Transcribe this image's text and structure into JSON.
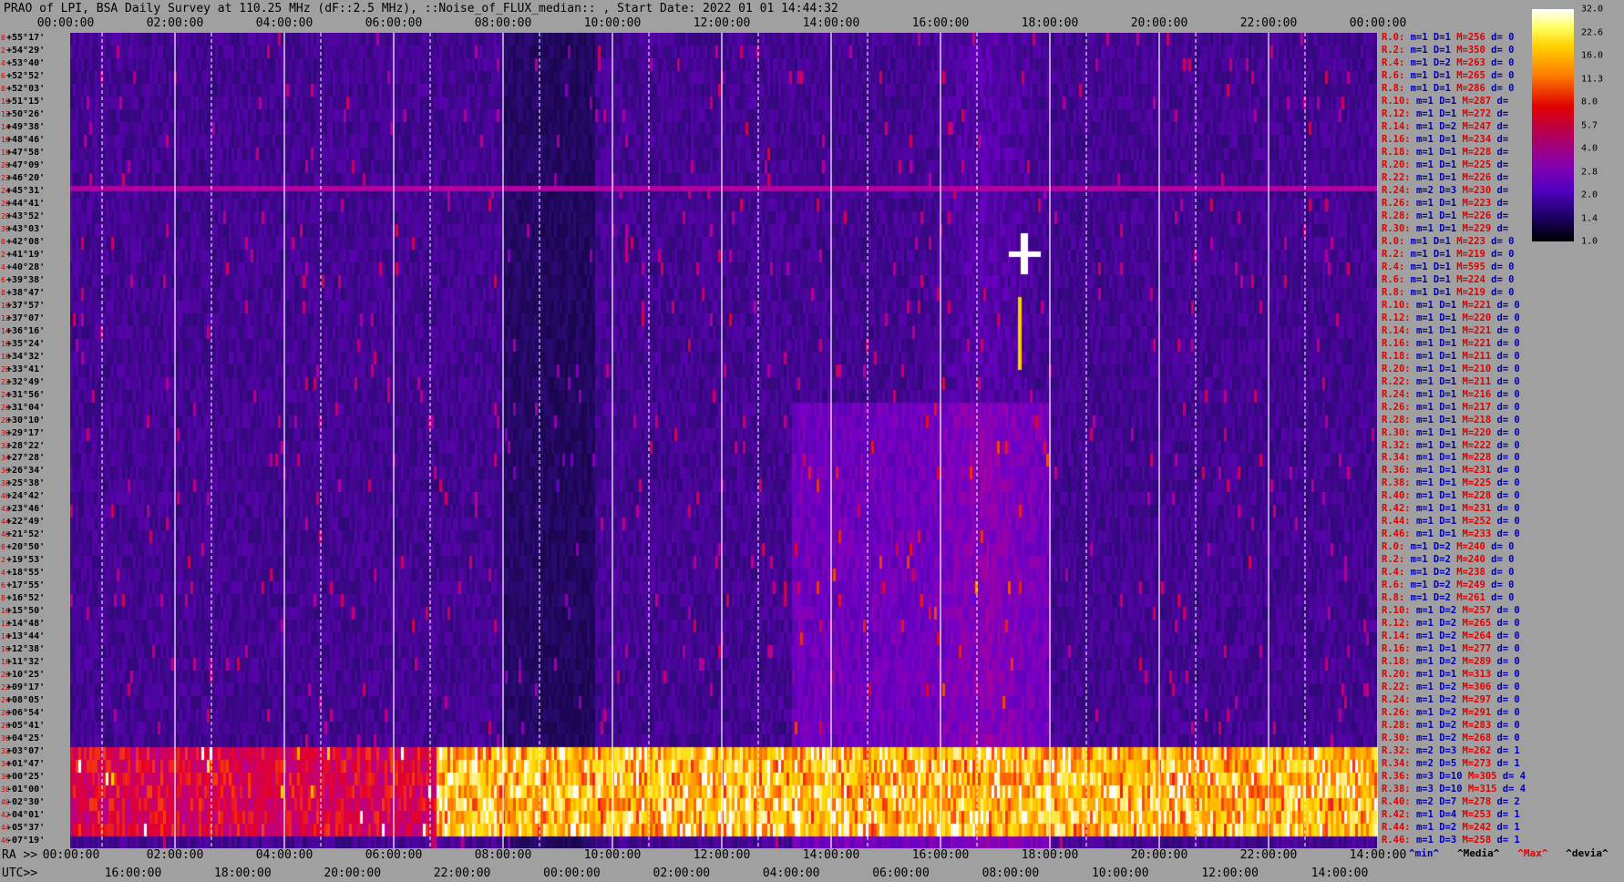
{
  "title": "PRAO of LPI, BSA Daily Survey at 110.25 MHz (dF::2.5 MHz), ::Noise_of_FLUX_median:: , Start Date: 2022 01 01 14:44:32",
  "top_axis": [
    "00:00:00",
    "02:00:00",
    "04:00:00",
    "06:00:00",
    "08:00:00",
    "10:00:00",
    "12:00:00",
    "14:00:00",
    "16:00:00",
    "18:00:00",
    "20:00:00",
    "22:00:00",
    "00:00:00"
  ],
  "ra_axis": [
    "00:00:00",
    "02:00:00",
    "04:00:00",
    "06:00:00",
    "08:00:00",
    "10:00:00",
    "12:00:00",
    "14:00:00",
    "16:00:00",
    "18:00:00",
    "20:00:00",
    "22:00:00",
    "14:00:00"
  ],
  "ra_label": "RA >>",
  "utc_axis": [
    "16:00:00",
    "18:00:00",
    "20:00:00",
    "22:00:00",
    "00:00:00",
    "02:00:00",
    "04:00:00",
    "06:00:00",
    "08:00:00",
    "10:00:00",
    "12:00:00",
    "14:00:00"
  ],
  "utc_label": "UTC>>",
  "declinations": [
    "+55°17'",
    "+54°29'",
    "+53°40'",
    "+52°52'",
    "+52°03'",
    "+51°15'",
    "+50°26'",
    "+49°38'",
    "+48°46'",
    "+47°58'",
    "+47°09'",
    "+46°20'",
    "+45°31'",
    "+44°41'",
    "+43°52'",
    "+43°03'",
    "+42°08'",
    "+41°19'",
    "+40°28'",
    "+39°38'",
    "+38°47'",
    "+37°57'",
    "+37°07'",
    "+36°16'",
    "+35°24'",
    "+34°32'",
    "+33°41'",
    "+32°49'",
    "+31°56'",
    "+31°04'",
    "+30°10'",
    "+29°17'",
    "+28°22'",
    "+27°28'",
    "+26°34'",
    "+25°38'",
    "+24°42'",
    "+23°46'",
    "+22°49'",
    "+21°52'",
    "+20°50'",
    "+19°53'",
    "+18°55'",
    "+17°55'",
    "+16°52'",
    "+15°50'",
    "+14°48'",
    "+13°44'",
    "+12°38'",
    "+11°32'",
    "+10°25'",
    "+09°17'",
    "+08°05'",
    "+06°54'",
    "+05°41'",
    "+04°25'",
    "+03°07'",
    "+01°47'",
    "+00°25'",
    "-01°00'",
    "-02°30'",
    "-04°01'",
    "-05°37'",
    "-07°19'"
  ],
  "row_numbers": [
    "0",
    "2",
    "4",
    "6",
    "8",
    "10",
    "12",
    "14",
    "16",
    "18",
    "20",
    "22",
    "24",
    "26",
    "28",
    "30",
    "0",
    "2",
    "4",
    "6",
    "8",
    "10",
    "12",
    "14",
    "16",
    "18",
    "20",
    "22",
    "24",
    "26",
    "28",
    "30",
    "32",
    "34",
    "36",
    "38",
    "40",
    "42",
    "44",
    "46",
    "0",
    "2",
    "4",
    "6",
    "8",
    "10",
    "12",
    "14",
    "16",
    "18",
    "20",
    "22",
    "24",
    "26",
    "28",
    "30",
    "32",
    "34",
    "36",
    "38",
    "40",
    "42",
    "44",
    "46"
  ],
  "stats": [
    {
      "r": "R.0:",
      "m": "m=1",
      "d": "D=1",
      "M": "M=256",
      "dv": "d= 0"
    },
    {
      "r": "R.2:",
      "m": "m=1",
      "d": "D=1",
      "M": "M=350",
      "dv": "d= 0"
    },
    {
      "r": "R.4:",
      "m": "m=1",
      "d": "D=2",
      "M": "M=263",
      "dv": "d= 0"
    },
    {
      "r": "R.6:",
      "m": "m=1",
      "d": "D=1",
      "M": "M=265",
      "dv": "d= 0"
    },
    {
      "r": "R.8:",
      "m": "m=1",
      "d": "D=1",
      "M": "M=286",
      "dv": "d= 0"
    },
    {
      "r": "R.10:",
      "m": "m=1",
      "d": "D=1",
      "M": "M=287",
      "dv": "d="
    },
    {
      "r": "R.12:",
      "m": "m=1",
      "d": "D=1",
      "M": "M=272",
      "dv": "d="
    },
    {
      "r": "R.14:",
      "m": "m=1",
      "d": "D=2",
      "M": "M=247",
      "dv": "d="
    },
    {
      "r": "R.16:",
      "m": "m=1",
      "d": "D=1",
      "M": "M=234",
      "dv": "d="
    },
    {
      "r": "R.18:",
      "m": "m=1",
      "d": "D=1",
      "M": "M=228",
      "dv": "d="
    },
    {
      "r": "R.20:",
      "m": "m=1",
      "d": "D=1",
      "M": "M=225",
      "dv": "d="
    },
    {
      "r": "R.22:",
      "m": "m=1",
      "d": "D=1",
      "M": "M=226",
      "dv": "d="
    },
    {
      "r": "R.24:",
      "m": "m=2",
      "d": "D=3",
      "M": "M=230",
      "dv": "d="
    },
    {
      "r": "R.26:",
      "m": "m=1",
      "d": "D=1",
      "M": "M=223",
      "dv": "d="
    },
    {
      "r": "R.28:",
      "m": "m=1",
      "d": "D=1",
      "M": "M=226",
      "dv": "d="
    },
    {
      "r": "R.30:",
      "m": "m=1",
      "d": "D=1",
      "M": "M=229",
      "dv": "d="
    },
    {
      "r": "R.0:",
      "m": "m=1",
      "d": "D=1",
      "M": "M=223",
      "dv": "d= 0"
    },
    {
      "r": "R.2:",
      "m": "m=1",
      "d": "D=1",
      "M": "M=219",
      "dv": "d= 0"
    },
    {
      "r": "R.4:",
      "m": "m=1",
      "d": "D=1",
      "M": "M=595",
      "dv": "d= 0"
    },
    {
      "r": "R.6:",
      "m": "m=1",
      "d": "D=1",
      "M": "M=224",
      "dv": "d= 0"
    },
    {
      "r": "R.8:",
      "m": "m=1",
      "d": "D=1",
      "M": "M=219",
      "dv": "d= 0"
    },
    {
      "r": "R.10:",
      "m": "m=1",
      "d": "D=1",
      "M": "M=221",
      "dv": "d= 0"
    },
    {
      "r": "R.12:",
      "m": "m=1",
      "d": "D=1",
      "M": "M=220",
      "dv": "d= 0"
    },
    {
      "r": "R.14:",
      "m": "m=1",
      "d": "D=1",
      "M": "M=221",
      "dv": "d= 0"
    },
    {
      "r": "R.16:",
      "m": "m=1",
      "d": "D=1",
      "M": "M=221",
      "dv": "d= 0"
    },
    {
      "r": "R.18:",
      "m": "m=1",
      "d": "D=1",
      "M": "M=211",
      "dv": "d= 0"
    },
    {
      "r": "R.20:",
      "m": "m=1",
      "d": "D=1",
      "M": "M=210",
      "dv": "d= 0"
    },
    {
      "r": "R.22:",
      "m": "m=1",
      "d": "D=1",
      "M": "M=211",
      "dv": "d= 0"
    },
    {
      "r": "R.24:",
      "m": "m=1",
      "d": "D=1",
      "M": "M=216",
      "dv": "d= 0"
    },
    {
      "r": "R.26:",
      "m": "m=1",
      "d": "D=1",
      "M": "M=217",
      "dv": "d= 0"
    },
    {
      "r": "R.28:",
      "m": "m=1",
      "d": "D=1",
      "M": "M=218",
      "dv": "d= 0"
    },
    {
      "r": "R.30:",
      "m": "m=1",
      "d": "D=1",
      "M": "M=220",
      "dv": "d= 0"
    },
    {
      "r": "R.32:",
      "m": "m=1",
      "d": "D=1",
      "M": "M=222",
      "dv": "d= 0"
    },
    {
      "r": "R.34:",
      "m": "m=1",
      "d": "D=1",
      "M": "M=228",
      "dv": "d= 0"
    },
    {
      "r": "R.36:",
      "m": "m=1",
      "d": "D=1",
      "M": "M=231",
      "dv": "d= 0"
    },
    {
      "r": "R.38:",
      "m": "m=1",
      "d": "D=1",
      "M": "M=225",
      "dv": "d= 0"
    },
    {
      "r": "R.40:",
      "m": "m=1",
      "d": "D=1",
      "M": "M=228",
      "dv": "d= 0"
    },
    {
      "r": "R.42:",
      "m": "m=1",
      "d": "D=1",
      "M": "M=231",
      "dv": "d= 0"
    },
    {
      "r": "R.44:",
      "m": "m=1",
      "d": "D=1",
      "M": "M=252",
      "dv": "d= 0"
    },
    {
      "r": "R.46:",
      "m": "m=1",
      "d": "D=1",
      "M": "M=233",
      "dv": "d= 0"
    },
    {
      "r": "R.0:",
      "m": "m=1",
      "d": "D=2",
      "M": "M=240",
      "dv": "d= 0"
    },
    {
      "r": "R.2:",
      "m": "m=1",
      "d": "D=2",
      "M": "M=240",
      "dv": "d= 0"
    },
    {
      "r": "R.4:",
      "m": "m=1",
      "d": "D=2",
      "M": "M=238",
      "dv": "d= 0"
    },
    {
      "r": "R.6:",
      "m": "m=1",
      "d": "D=2",
      "M": "M=249",
      "dv": "d= 0"
    },
    {
      "r": "R.8:",
      "m": "m=1",
      "d": "D=2",
      "M": "M=261",
      "dv": "d= 0"
    },
    {
      "r": "R.10:",
      "m": "m=1",
      "d": "D=2",
      "M": "M=257",
      "dv": "d= 0"
    },
    {
      "r": "R.12:",
      "m": "m=1",
      "d": "D=2",
      "M": "M=265",
      "dv": "d= 0"
    },
    {
      "r": "R.14:",
      "m": "m=1",
      "d": "D=2",
      "M": "M=264",
      "dv": "d= 0"
    },
    {
      "r": "R.16:",
      "m": "m=1",
      "d": "D=1",
      "M": "M=277",
      "dv": "d= 0"
    },
    {
      "r": "R.18:",
      "m": "m=1",
      "d": "D=2",
      "M": "M=289",
      "dv": "d= 0"
    },
    {
      "r": "R.20:",
      "m": "m=1",
      "d": "D=1",
      "M": "M=313",
      "dv": "d= 0"
    },
    {
      "r": "R.22:",
      "m": "m=1",
      "d": "D=2",
      "M": "M=306",
      "dv": "d= 0"
    },
    {
      "r": "R.24:",
      "m": "m=1",
      "d": "D=2",
      "M": "M=297",
      "dv": "d= 0"
    },
    {
      "r": "R.26:",
      "m": "m=1",
      "d": "D=2",
      "M": "M=291",
      "dv": "d= 0"
    },
    {
      "r": "R.28:",
      "m": "m=1",
      "d": "D=2",
      "M": "M=283",
      "dv": "d= 0"
    },
    {
      "r": "R.30:",
      "m": "m=1",
      "d": "D=2",
      "M": "M=268",
      "dv": "d= 0"
    },
    {
      "r": "R.32:",
      "m": "m=2",
      "d": "D=3",
      "M": "M=262",
      "dv": "d= 1"
    },
    {
      "r": "R.34:",
      "m": "m=2",
      "d": "D=5",
      "M": "M=273",
      "dv": "d= 1"
    },
    {
      "r": "R.36:",
      "m": "m=3",
      "d": "D=10",
      "M": "M=305",
      "dv": "d= 4"
    },
    {
      "r": "R.38:",
      "m": "m=3",
      "d": "D=10",
      "M": "M=315",
      "dv": "d= 4"
    },
    {
      "r": "R.40:",
      "m": "m=2",
      "d": "D=7",
      "M": "M=278",
      "dv": "d= 2"
    },
    {
      "r": "R.42:",
      "m": "m=1",
      "d": "D=4",
      "M": "M=253",
      "dv": "d= 1"
    },
    {
      "r": "R.44:",
      "m": "m=1",
      "d": "D=2",
      "M": "M=242",
      "dv": "d= 1"
    },
    {
      "r": "R.46:",
      "m": "m=1",
      "d": "D=3",
      "M": "M=258",
      "dv": "d= 1"
    }
  ],
  "colorbar": [
    "32.0",
    "22.6",
    "16.0",
    "11.3",
    "8.0",
    "5.7",
    "4.0",
    "2.8",
    "2.0",
    "1.4",
    "1.0"
  ],
  "legend": {
    "min": "^min^",
    "media": "^Media^",
    "max": "^Max^",
    "devia": "^devia^"
  },
  "chart_data": {
    "type": "heatmap",
    "title": "PRAO of LPI, BSA Daily Survey at 110.25 MHz (dF::2.5 MHz), ::Noise_of_FLUX_median:: , Start Date: 2022 01 01 14:44:32",
    "xlabel": "RA >> / UTC>>",
    "colorbar_range": [
      1.0,
      32.0
    ],
    "colorbar_scale": "log",
    "x_range": [
      "00:00:00",
      "24:00:00"
    ],
    "y_range": [
      "+55°17'",
      "-07°19'"
    ]
  }
}
